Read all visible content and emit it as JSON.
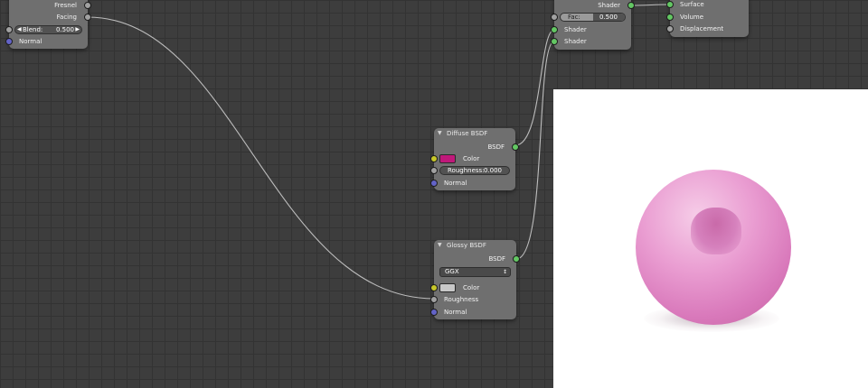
{
  "colors": {
    "socket_shader": "#63c763",
    "socket_float": "#a1a1a1",
    "socket_color": "#c7c729",
    "socket_vector": "#6363c7",
    "diffuse_color": "#c0187a",
    "glossy_color": "#c8c8c8",
    "preview_material": "#e79bd0"
  },
  "layer_weight_node": {
    "outputs": [
      "Fresnel",
      "Facing"
    ],
    "blend": {
      "label": "Blend:",
      "value": "0.500"
    },
    "inputs": [
      "Normal"
    ]
  },
  "mix_shader_node": {
    "output": "Shader",
    "fac": {
      "label": "Fac:",
      "value": "0.500"
    },
    "inputs": [
      "Shader",
      "Shader"
    ]
  },
  "material_output_node": {
    "inputs": [
      "Surface",
      "Volume",
      "Displacement"
    ]
  },
  "diffuse_node": {
    "title": "Diffuse BSDF",
    "output": "BSDF",
    "color_label": "Color",
    "roughness": {
      "label": "Roughness:",
      "value": "0.000"
    },
    "normal_label": "Normal"
  },
  "glossy_node": {
    "title": "Glossy BSDF",
    "output": "BSDF",
    "distribution": "GGX",
    "color_label": "Color",
    "roughness_label": "Roughness",
    "normal_label": "Normal"
  },
  "icons": {
    "collapse": "collapse-arrow-icon",
    "slider_left": "decrement-arrow-icon",
    "slider_right": "increment-arrow-icon",
    "dropdown": "dropdown-arrows-icon"
  },
  "sliders": {
    "blend_fill": 0.5,
    "fac_fill": 0.5,
    "roughness_fill": 0.0
  }
}
